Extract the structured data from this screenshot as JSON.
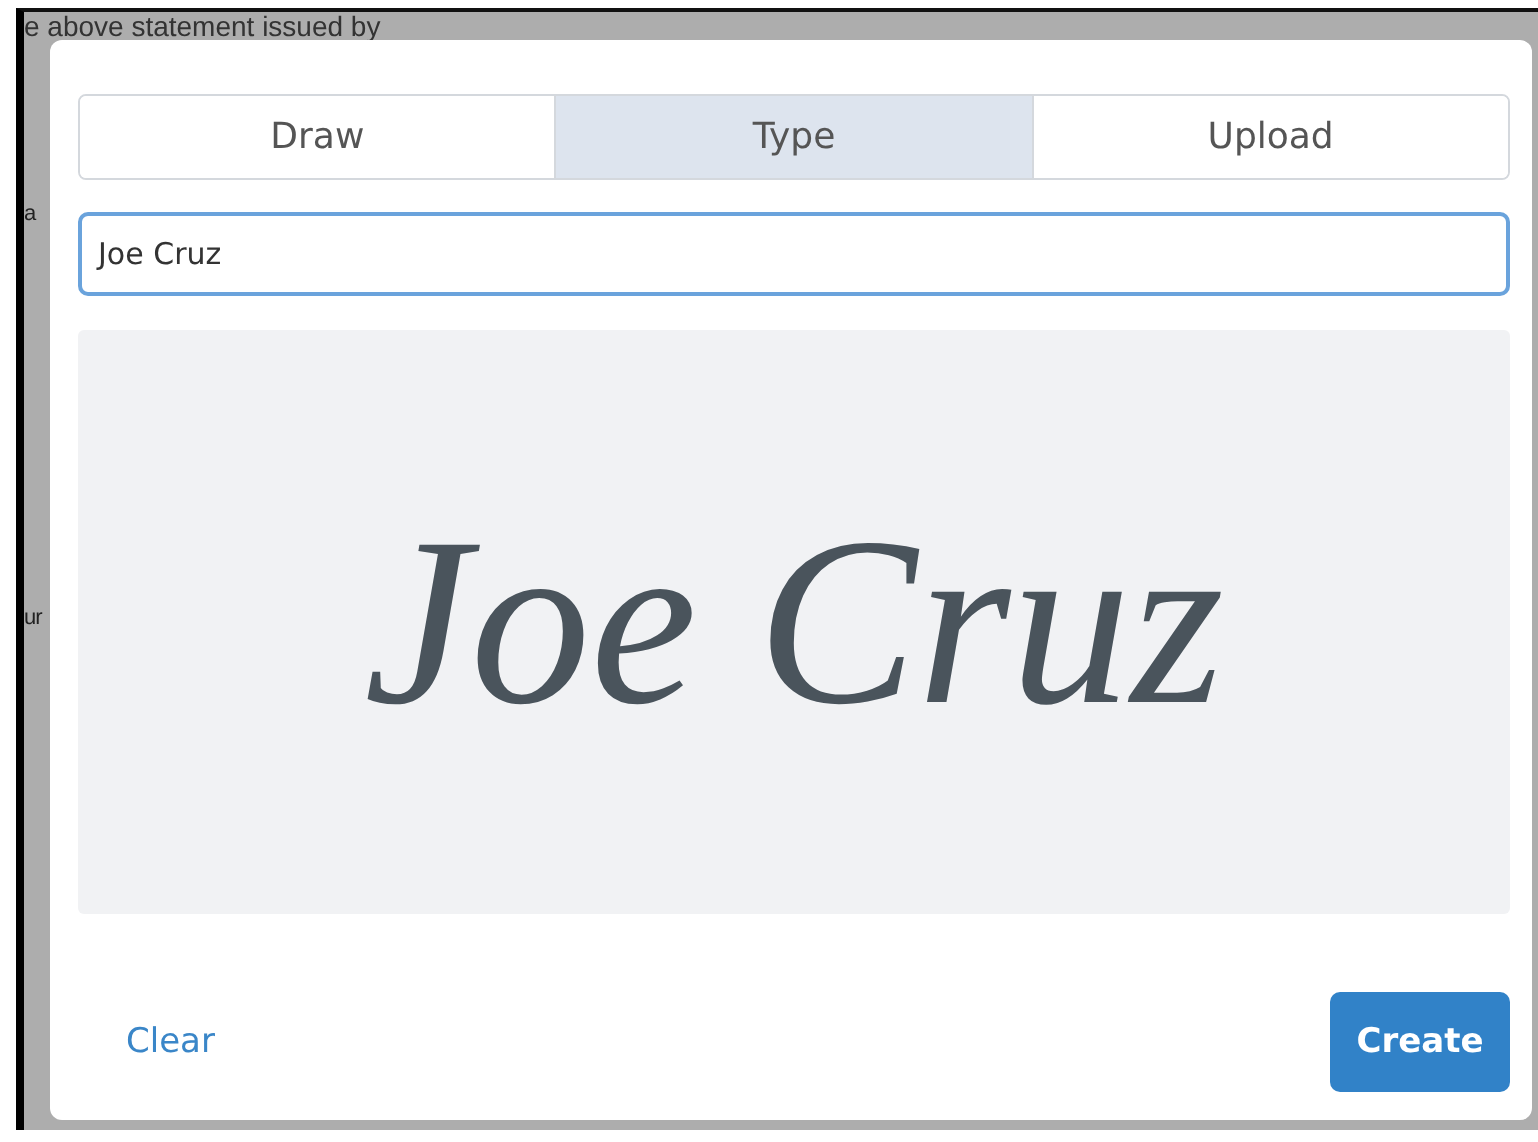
{
  "background": {
    "heading": "e above statement issued by",
    "fragments": [
      "a",
      "ur"
    ]
  },
  "tabs": [
    {
      "label": "Draw",
      "selected": false
    },
    {
      "label": "Type",
      "selected": true
    },
    {
      "label": "Upload",
      "selected": false
    }
  ],
  "name_field": {
    "value": "Joe Cruz"
  },
  "signature_preview": {
    "text": "Joe Cruz"
  },
  "buttons": {
    "clear": "Clear",
    "create": "Create"
  }
}
